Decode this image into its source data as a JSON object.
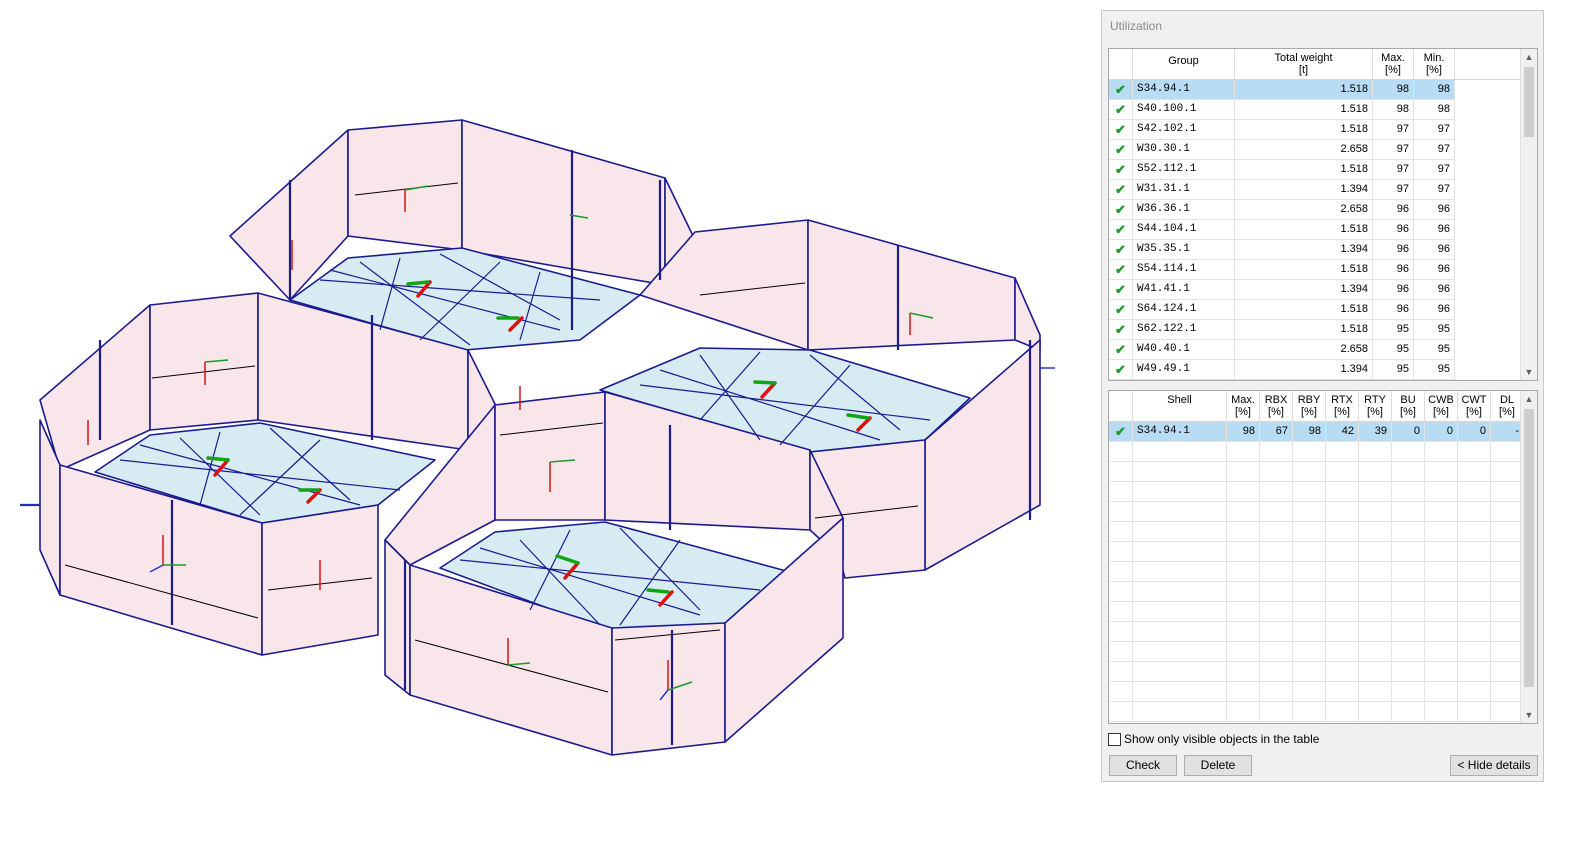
{
  "panel": {
    "title": "Utilization",
    "show_visible_label": "Show only visible objects in the table",
    "show_visible_checked": false,
    "buttons": {
      "check": "Check",
      "delete": "Delete",
      "hide_details": "< Hide details"
    }
  },
  "group_table": {
    "headers": {
      "group": "Group",
      "weight": [
        "Total weight",
        "[t]"
      ],
      "max": [
        "Max.",
        "[%]"
      ],
      "min": [
        "Min.",
        "[%]"
      ]
    },
    "rows": [
      {
        "group": "S34.94.1",
        "weight": "1.518",
        "max": "98",
        "min": "98",
        "selected": true
      },
      {
        "group": "S40.100.1",
        "weight": "1.518",
        "max": "98",
        "min": "98"
      },
      {
        "group": "S42.102.1",
        "weight": "1.518",
        "max": "97",
        "min": "97"
      },
      {
        "group": "W30.30.1",
        "weight": "2.658",
        "max": "97",
        "min": "97"
      },
      {
        "group": "S52.112.1",
        "weight": "1.518",
        "max": "97",
        "min": "97"
      },
      {
        "group": "W31.31.1",
        "weight": "1.394",
        "max": "97",
        "min": "97"
      },
      {
        "group": "W36.36.1",
        "weight": "2.658",
        "max": "96",
        "min": "96"
      },
      {
        "group": "S44.104.1",
        "weight": "1.518",
        "max": "96",
        "min": "96"
      },
      {
        "group": "W35.35.1",
        "weight": "1.394",
        "max": "96",
        "min": "96"
      },
      {
        "group": "S54.114.1",
        "weight": "1.518",
        "max": "96",
        "min": "96"
      },
      {
        "group": "W41.41.1",
        "weight": "1.394",
        "max": "96",
        "min": "96"
      },
      {
        "group": "S64.124.1",
        "weight": "1.518",
        "max": "96",
        "min": "96"
      },
      {
        "group": "S62.122.1",
        "weight": "1.518",
        "max": "95",
        "min": "95"
      },
      {
        "group": "W40.40.1",
        "weight": "2.658",
        "max": "95",
        "min": "95"
      },
      {
        "group": "W49.49.1",
        "weight": "1.394",
        "max": "95",
        "min": "95"
      }
    ]
  },
  "shell_table": {
    "headers": [
      [
        "Shell",
        ""
      ],
      [
        "Max.",
        "[%]"
      ],
      [
        "RBX",
        "[%]"
      ],
      [
        "RBY",
        "[%]"
      ],
      [
        "RTX",
        "[%]"
      ],
      [
        "RTY",
        "[%]"
      ],
      [
        "BU",
        "[%]"
      ],
      [
        "CWB",
        "[%]"
      ],
      [
        "CWT",
        "[%]"
      ],
      [
        "DL",
        "[%]"
      ]
    ],
    "rows": [
      {
        "shell": "S34.94.1",
        "max": "98",
        "rbx": "67",
        "rby": "98",
        "rtx": "42",
        "rty": "39",
        "bu": "0",
        "cwb": "0",
        "cwt": "0",
        "dl": "-"
      }
    ]
  },
  "colors": {
    "wall_fill": "#f9e6ea",
    "floor_fill": "#d6ebf2",
    "edge": "#1b1b8f",
    "selection": "#b9dcf5",
    "check": "#1c9a2a"
  },
  "icons": [
    "checkmark-icon",
    "scroll-up-arrow-icon",
    "scroll-down-arrow-icon"
  ]
}
